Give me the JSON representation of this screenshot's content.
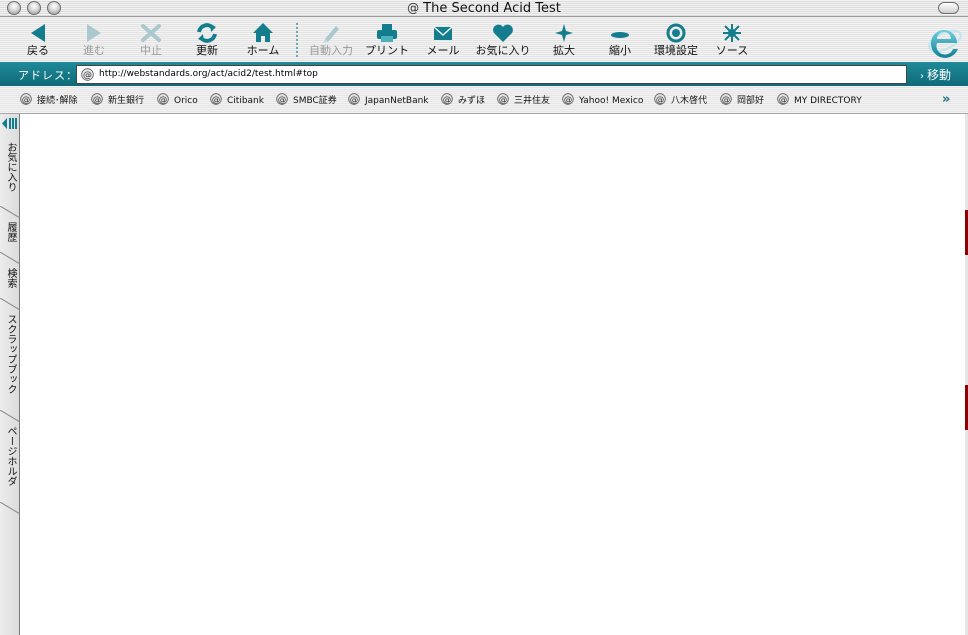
{
  "window": {
    "title": "The Second Acid Test",
    "title_icon": "@"
  },
  "toolbar": {
    "items": [
      {
        "label": "戻る",
        "icon": "back-arrow-icon",
        "enabled": true
      },
      {
        "label": "進む",
        "icon": "forward-arrow-icon",
        "enabled": false
      },
      {
        "label": "中止",
        "icon": "stop-x-icon",
        "enabled": false
      },
      {
        "label": "更新",
        "icon": "refresh-icon",
        "enabled": true
      },
      {
        "label": "ホーム",
        "icon": "home-icon",
        "enabled": true
      },
      {
        "label": "自動入力",
        "icon": "autofill-pen-icon",
        "enabled": false
      },
      {
        "label": "プリント",
        "icon": "printer-icon",
        "enabled": true
      },
      {
        "label": "メール",
        "icon": "mail-envelope-icon",
        "enabled": true
      },
      {
        "label": "お気に入り",
        "icon": "heart-icon",
        "enabled": true
      },
      {
        "label": "拡大",
        "icon": "enlarge-plus-icon",
        "enabled": true
      },
      {
        "label": "縮小",
        "icon": "shrink-minus-icon",
        "enabled": true
      },
      {
        "label": "環境設定",
        "icon": "preferences-icon",
        "enabled": true
      },
      {
        "label": "ソース",
        "icon": "source-burst-icon",
        "enabled": true
      }
    ]
  },
  "address": {
    "label": "アドレス：",
    "url": "http://webstandards.org/act/acid2/test.html#top",
    "go_label": "移動"
  },
  "favorites": {
    "items": [
      "接続･解除",
      "新生銀行",
      "Orico",
      "Citibank",
      "SMBC証券",
      "JapanNetBank",
      "みずほ",
      "三井住友",
      "Yahoo! Mexico",
      "八木啓代",
      "岡部好",
      "MY DIRECTORY"
    ],
    "more": "»"
  },
  "sidebar": {
    "tabs": [
      "お気に入り",
      "履歴",
      "検索",
      "スクラップブック",
      "ページホルダ"
    ]
  },
  "colors": {
    "accent": "#1f8a99",
    "icon_teal": "#137d8e",
    "disabled": "#a9c9cf"
  }
}
